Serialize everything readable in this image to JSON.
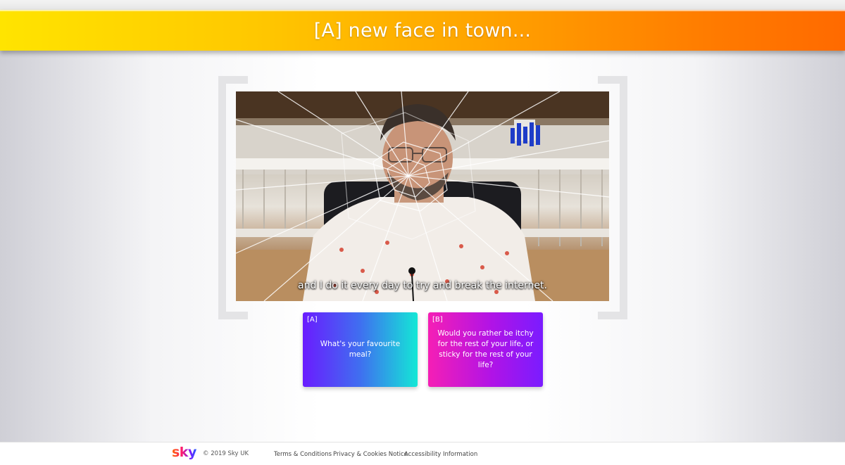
{
  "header": {
    "title": "[A] new face in town..."
  },
  "video": {
    "subtitle": "and I do it every day to try and break the internet."
  },
  "answers": [
    {
      "tag": "[A]",
      "text": "What's your favourite meal?"
    },
    {
      "tag": "[B]",
      "text": "Would you rather be itchy for the rest of your life, or sticky for the rest of your life?"
    }
  ],
  "footer": {
    "logo": "sky",
    "copyright": "© 2019 Sky UK",
    "links": [
      "Terms & Conditions",
      "Privacy & Cookies Notice",
      "Accessibility Information"
    ]
  },
  "colors": {
    "header_gradient_start": "#ffe400",
    "header_gradient_end": "#ff6a00",
    "card_a_gradient": [
      "#6a1cff",
      "#14e7d6"
    ],
    "card_b_gradient": [
      "#f51fb5",
      "#7a1cff"
    ]
  }
}
